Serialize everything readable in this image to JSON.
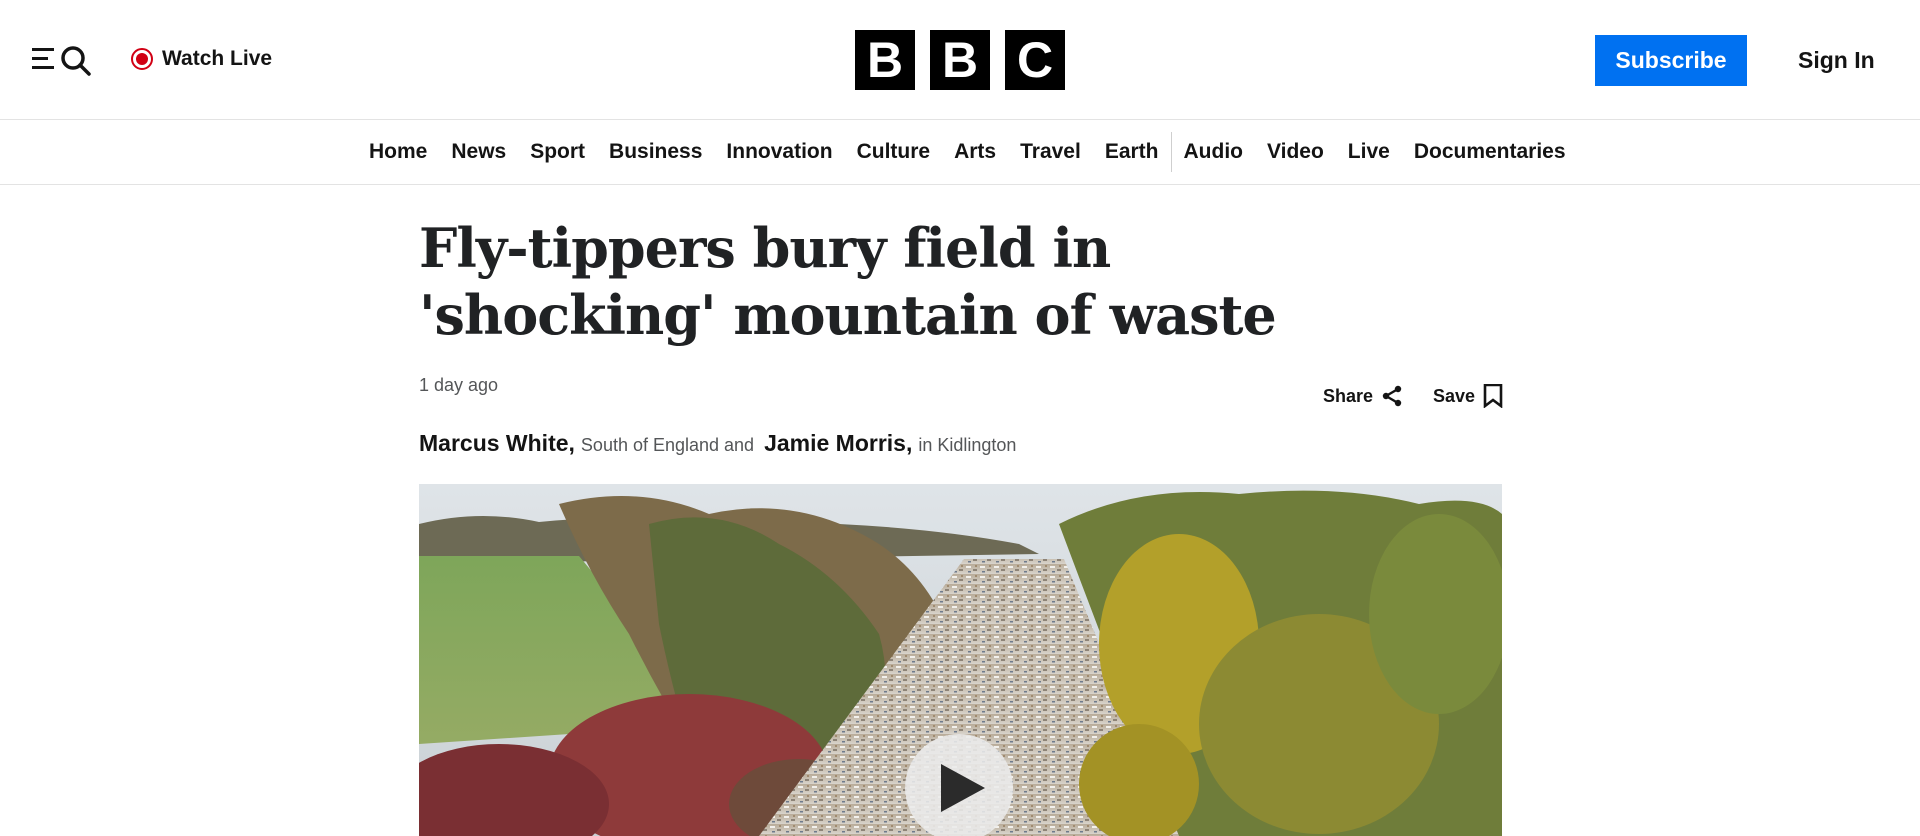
{
  "header": {
    "watch_live_label": "Watch Live",
    "logo_letters": [
      "B",
      "B",
      "C"
    ],
    "subscribe_label": "Subscribe",
    "signin_label": "Sign In",
    "accent_color": "#0071f1",
    "live_color": "#d10014"
  },
  "nav": {
    "items": [
      "Home",
      "News",
      "Sport",
      "Business",
      "Innovation",
      "Culture",
      "Arts",
      "Travel",
      "Earth",
      "Audio",
      "Video",
      "Live",
      "Documentaries"
    ]
  },
  "article": {
    "headline": "Fly-tippers bury field in 'shocking' mountain of waste",
    "timestamp": "1 day ago",
    "share_label": "Share",
    "save_label": "Save",
    "authors": [
      {
        "name": "Marcus White,",
        "role": "South of England and"
      },
      {
        "name": "Jamie Morris,",
        "role": "in Kidlington"
      }
    ]
  },
  "icons": {
    "menu": "menu-icon",
    "search": "search-icon",
    "live": "live-dot-icon",
    "share": "share-icon",
    "save": "bookmark-icon",
    "play": "play-icon"
  }
}
